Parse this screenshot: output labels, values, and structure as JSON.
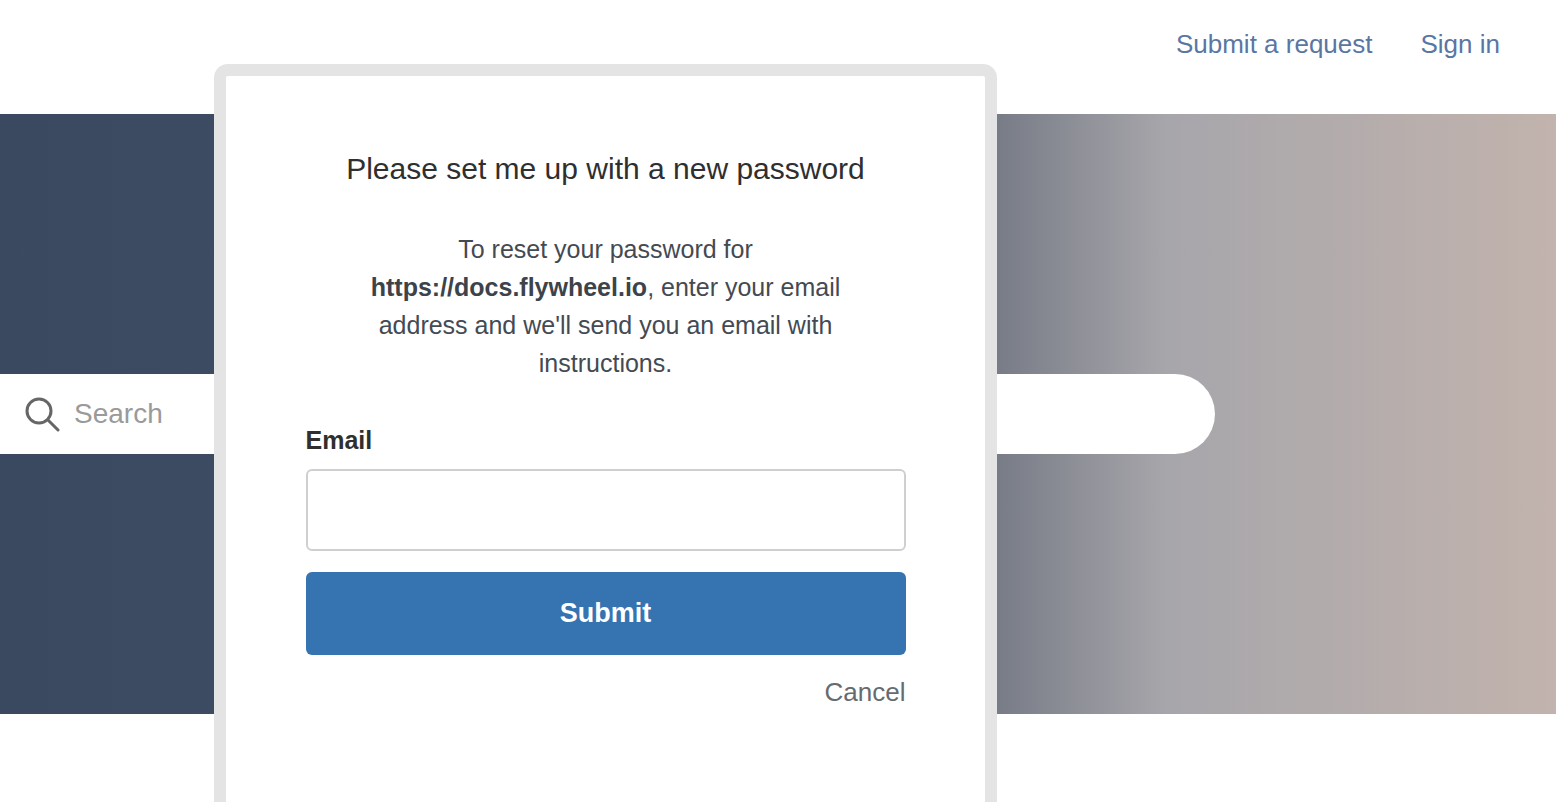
{
  "header": {
    "links": [
      "Submit a request",
      "Sign in"
    ]
  },
  "search": {
    "placeholder": "Search"
  },
  "modal": {
    "title": "Please set me up with a new password",
    "description": {
      "before": "To reset your password for",
      "link": "https://docs.flywheel.io",
      "after": ", enter your email address and we'll send you an email with instructions."
    },
    "email": {
      "label": "Email",
      "value": ""
    },
    "submit": "Submit",
    "cancel": "Cancel"
  }
}
